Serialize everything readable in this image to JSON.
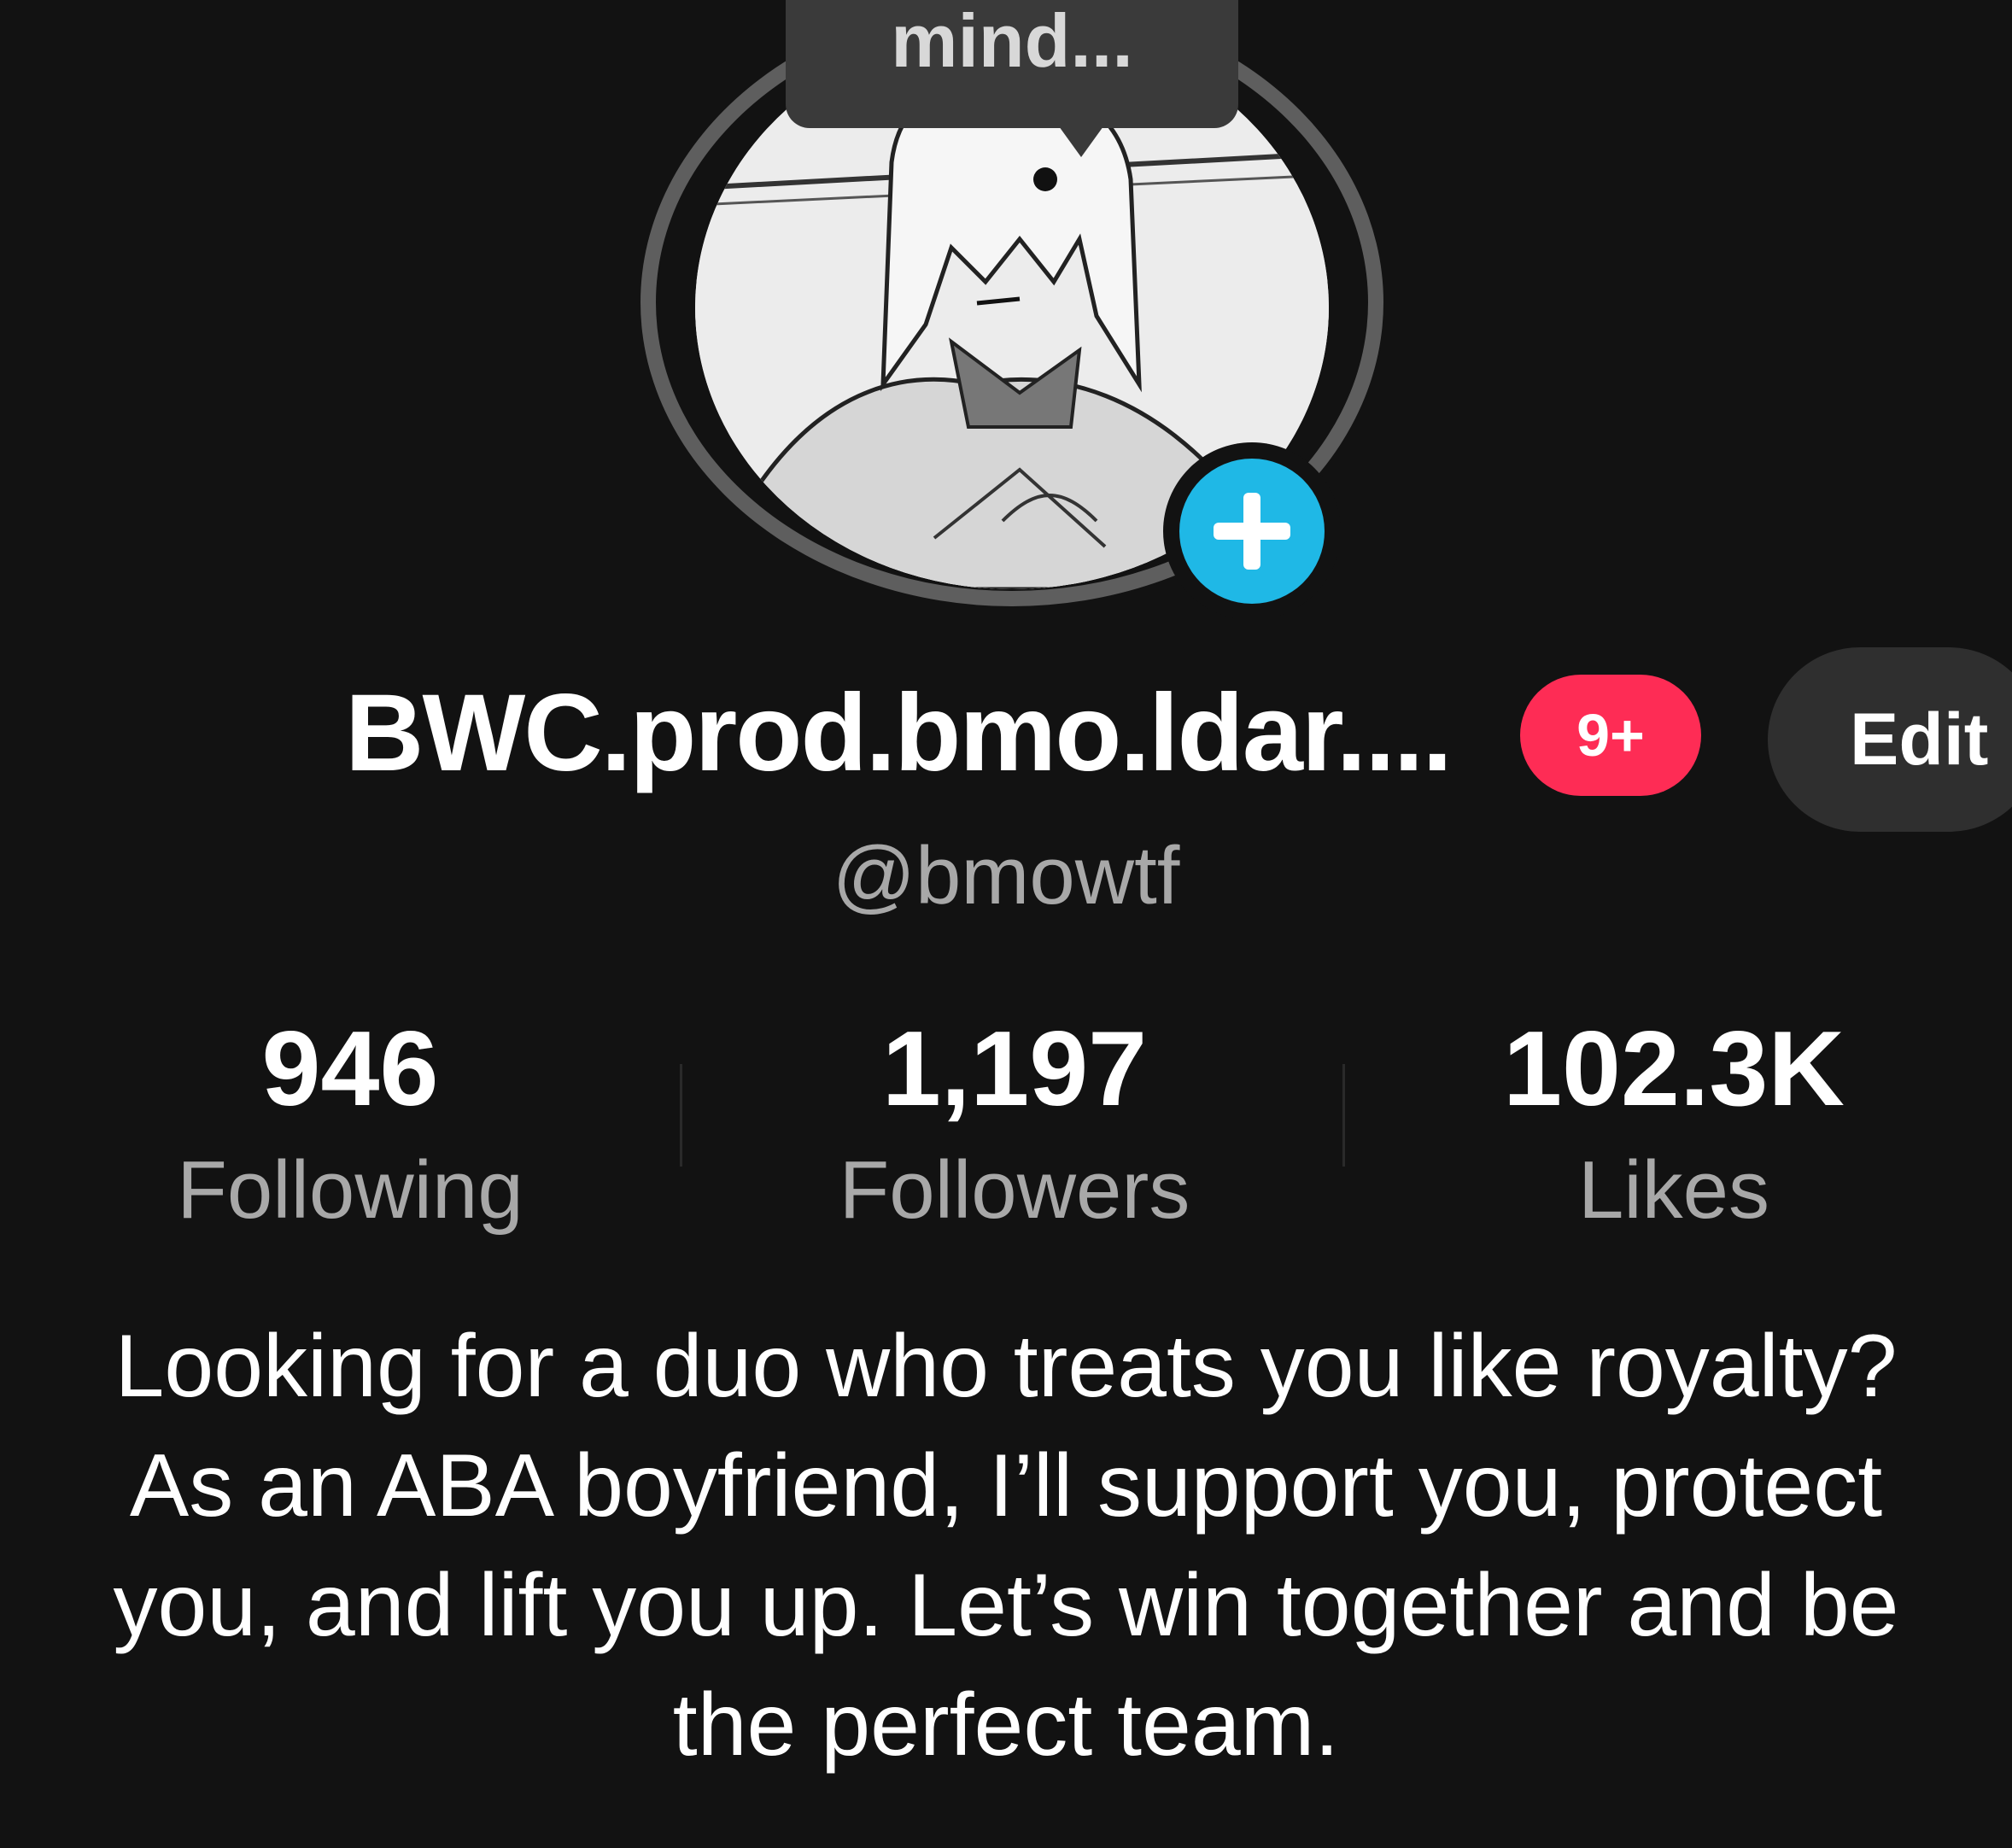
{
  "status_bubble": {
    "text": "mind..."
  },
  "profile": {
    "display_name": "BWC.prod.bmo.ldar....",
    "notification_badge": "9+",
    "edit_label": "Edit",
    "handle": "@bmowtf"
  },
  "stats": {
    "following": {
      "value": "946",
      "label": "Following"
    },
    "followers": {
      "value": "1,197",
      "label": "Followers"
    },
    "likes": {
      "value": "102.3K",
      "label": "Likes"
    }
  },
  "bio": {
    "lines": [
      "Looking for a duo who treats you like royalty?",
      "As an ABA boyfriend, I’ll support you, protect",
      "you, and lift you up. Let’s win together and be",
      "the perfect team."
    ]
  },
  "colors": {
    "background": "#121212",
    "badge": "#fe2c55",
    "add_button": "#1fb8e6",
    "secondary_text": "#a8a8a8"
  },
  "icons": {
    "add": "plus-icon"
  }
}
